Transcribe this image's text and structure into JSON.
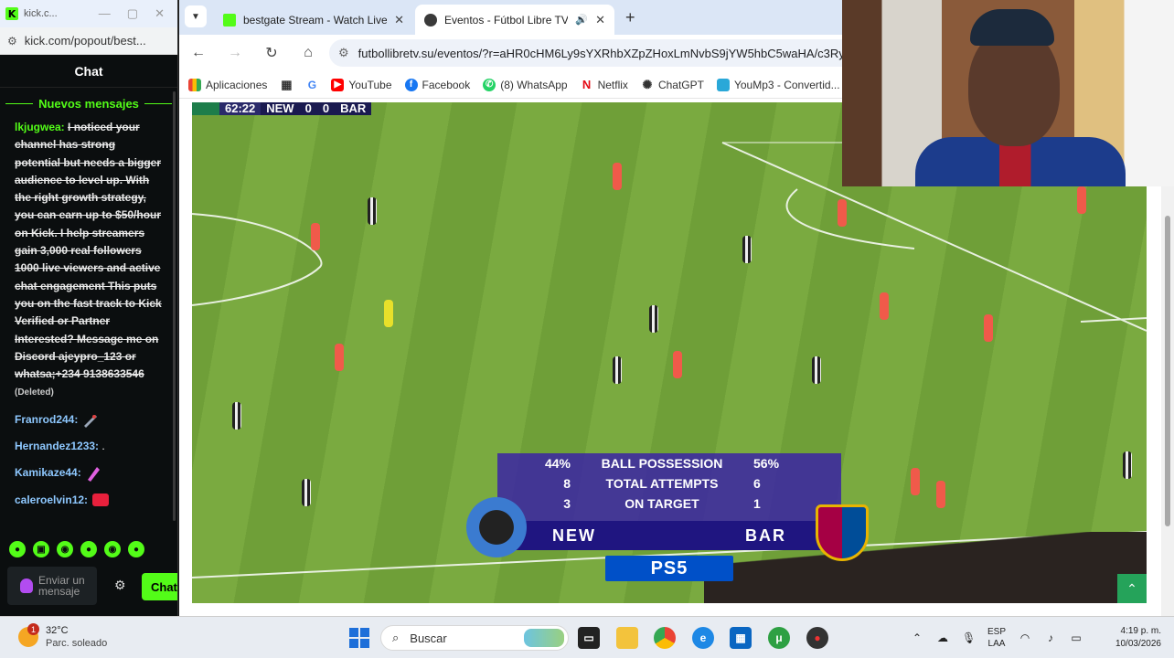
{
  "kick_popout": {
    "window_title": "kick.c...",
    "url": "kick.com/popout/best...",
    "chat_header": "Chat",
    "new_messages_label": "Nuevos mensajes",
    "messages": [
      {
        "user": "lkjugwea:",
        "user_color": "#53fc18",
        "text": "I noticed your channel has strong potential but needs a bigger audience to level up. With the right growth strategy, you can earn up to $50/hour on Kick. I help streamers gain 3,000 real followers 1000 live viewers and active chat engagement This puts you on the fast track to Kick Verified or Partner Interested? Message me on Discord ajeypro_123 or whatsa;+234 9138633546",
        "deleted_label": "(Deleted)"
      },
      {
        "user": "Franrod244:",
        "user_color": "#8ec8ff",
        "emote": "rocket-emote"
      },
      {
        "user": "Hernandez1233:",
        "user_color": "#8ec8ff",
        "text": "."
      },
      {
        "user": "Kamikaze44:",
        "user_color": "#8ec8ff",
        "emote": "pink-emote"
      },
      {
        "user": "caleroelvin12:",
        "user_color": "#8ec8ff",
        "emote": "red-emote"
      }
    ],
    "input_placeholder": "Enviar un mensaje",
    "send_label": "Chat"
  },
  "browser": {
    "tabs": [
      {
        "title": "bestgate Stream - Watch Live o",
        "icon": "kick-icon",
        "active": false
      },
      {
        "title": "Eventos - Fútbol Libre TV",
        "icon": "soccer-icon",
        "active": true
      }
    ],
    "url": "futbollibretv.su/eventos/?r=aHR0cHM6Ly9sYXRhbXZpZHoxLmNvbS9jYW5hbC5waHA/c3RyZW",
    "bookmarks": [
      {
        "label": "Aplicaciones",
        "icon": "apps-icon"
      },
      {
        "label": "",
        "icon": "google-icon"
      },
      {
        "label": "YouTube",
        "icon": "youtube-icon"
      },
      {
        "label": "Facebook",
        "icon": "facebook-icon"
      },
      {
        "label": "(8) WhatsApp",
        "icon": "whatsapp-icon"
      },
      {
        "label": "Netflix",
        "icon": "netflix-icon"
      },
      {
        "label": "ChatGPT",
        "icon": "chatgpt-icon"
      },
      {
        "label": "YouMp3 - Convertid...",
        "icon": "yoump3-icon"
      }
    ]
  },
  "match": {
    "clock": "62:22",
    "home_short": "NEW",
    "home_score": "0",
    "away_score": "0",
    "away_short": "BAR",
    "stats": [
      {
        "home": "44%",
        "label": "BALL POSSESSION",
        "away": "56%"
      },
      {
        "home": "8",
        "label": "TOTAL ATTEMPTS",
        "away": "6"
      },
      {
        "home": "3",
        "label": "ON TARGET",
        "away": "1"
      }
    ],
    "team_home": "NEW",
    "team_away": "BAR",
    "sponsor": "PS5"
  },
  "taskbar": {
    "weather_temp": "32°C",
    "weather_cond": "Parc. soleado",
    "weather_badge": "1",
    "search_placeholder": "Buscar",
    "lang_line1": "ESP",
    "lang_line2": "LAA",
    "time": "4:19 p. m.",
    "date": "10/03/2026"
  }
}
